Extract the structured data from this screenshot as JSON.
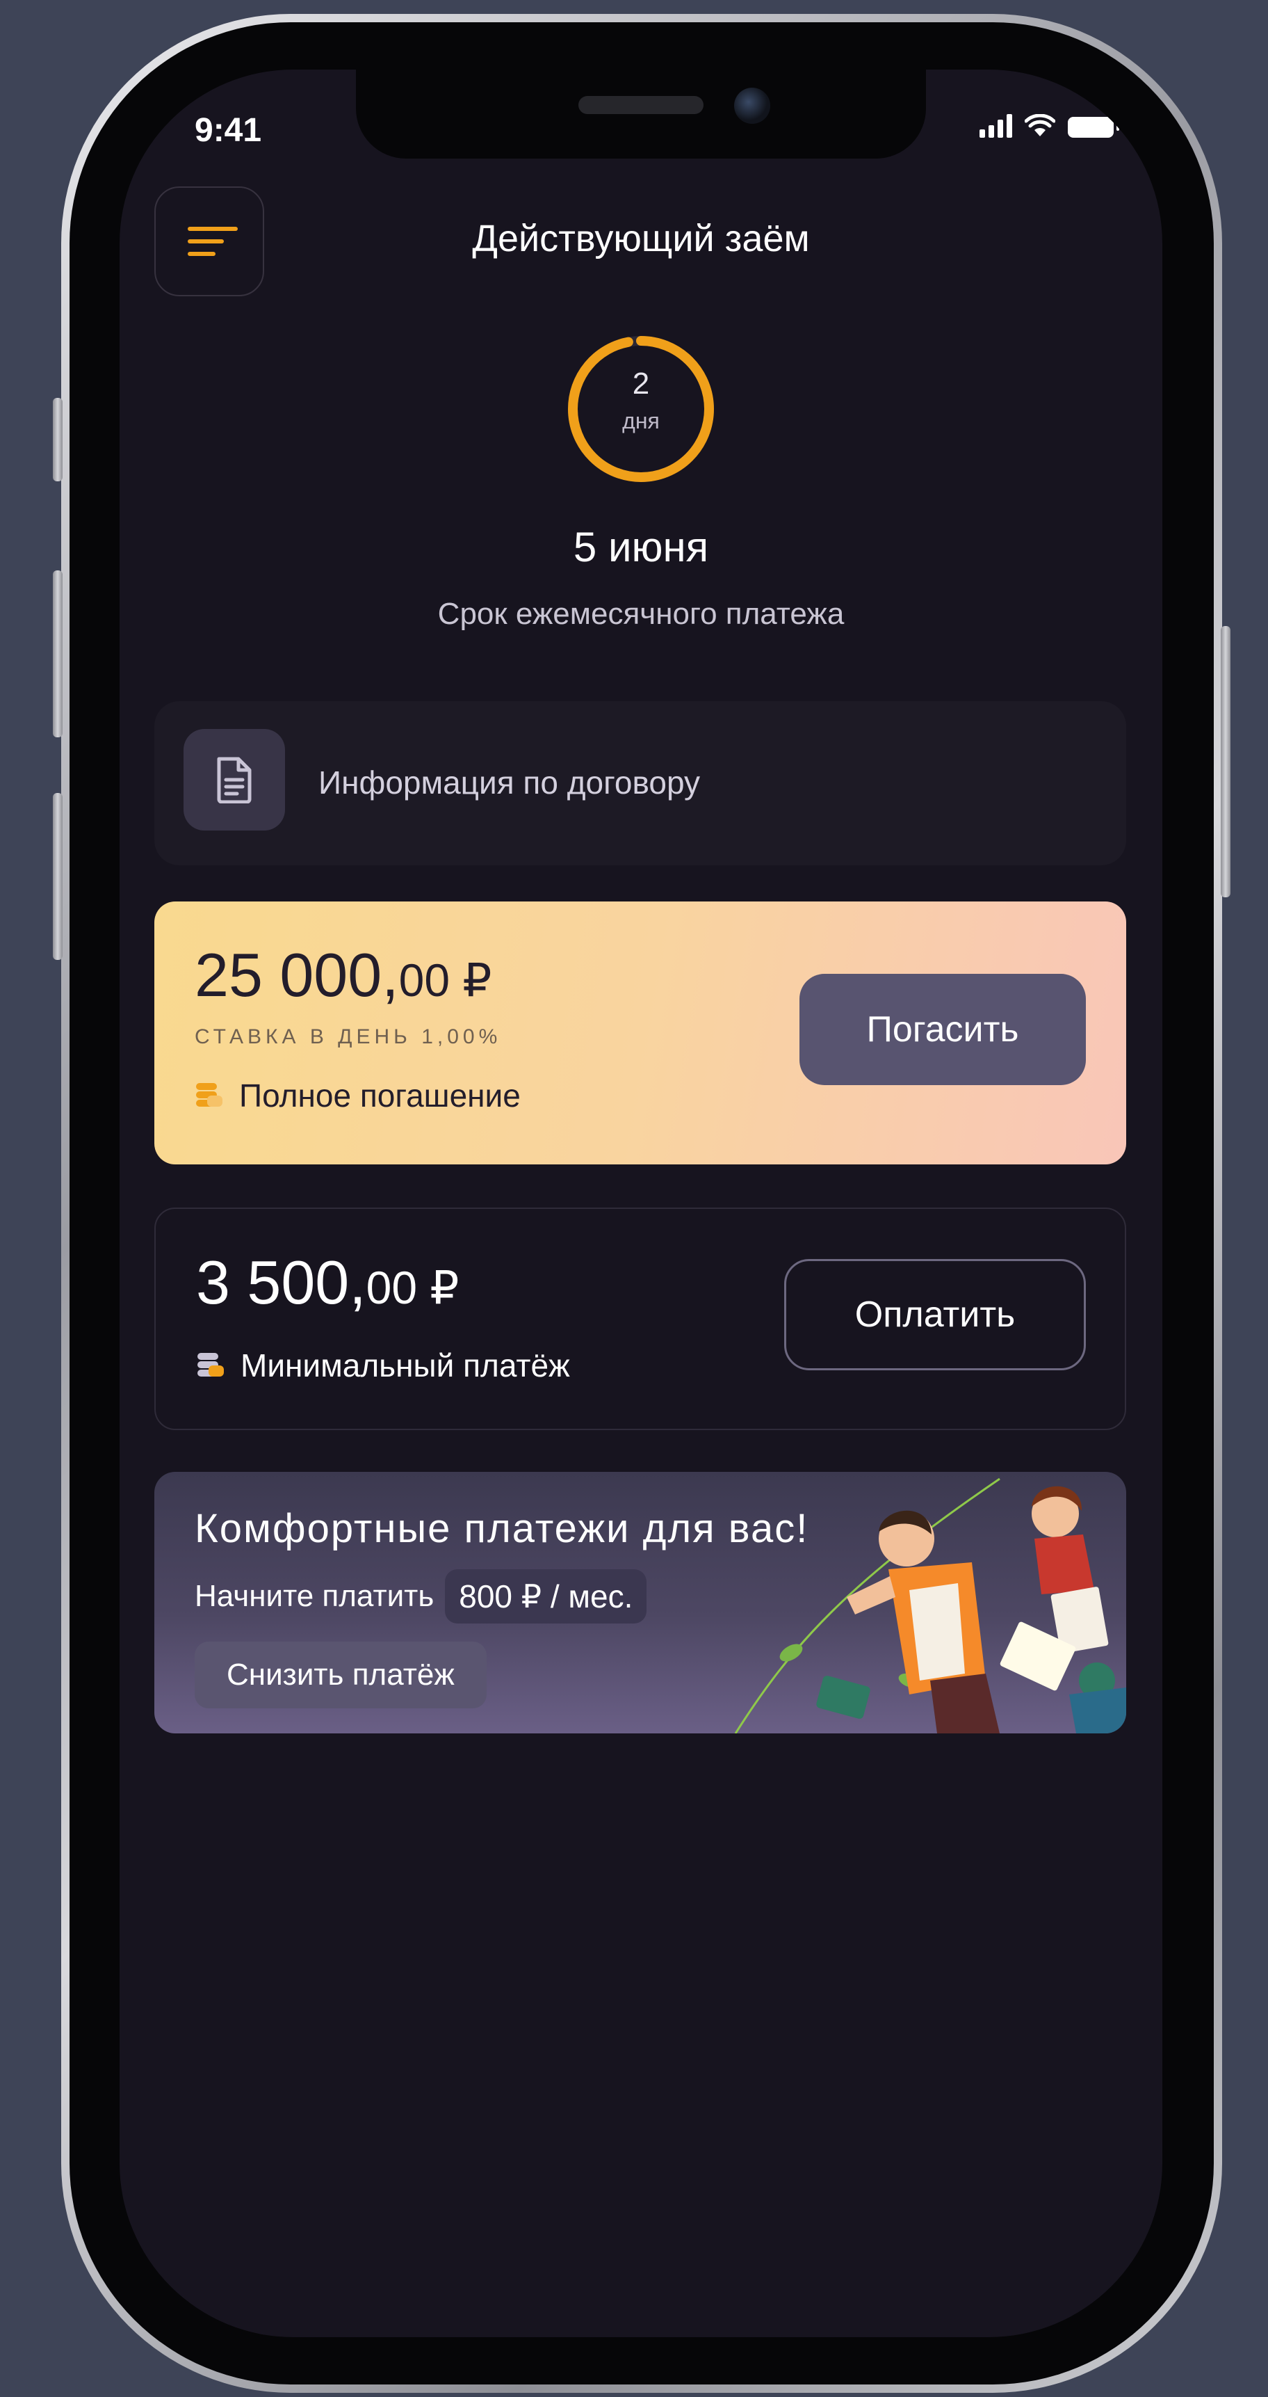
{
  "status_bar": {
    "time": "9:41"
  },
  "header": {
    "title": "Действующий заём"
  },
  "countdown": {
    "number": "2",
    "unit": "дня",
    "progress": 0.97
  },
  "due": {
    "date": "5 июня",
    "caption": "Срок ежемесячного платежа"
  },
  "contract": {
    "label": "Информация по договору"
  },
  "full_repayment": {
    "amount_main": "25 000,",
    "amount_cents": "00 ₽",
    "rate": "СТАВКА В ДЕНЬ 1,00%",
    "label": "Полное погашение",
    "button_label": "Погасить"
  },
  "minimum_payment": {
    "amount_main": "3 500,",
    "amount_cents": "00 ₽",
    "label": "Минимальный платёж",
    "button_label": "Оплатить"
  },
  "promo": {
    "title": "Комфортные платежи для вас!",
    "subtitle": "Начните платить",
    "chip": "800 ₽ / мес.",
    "button_label": "Снизить платёж"
  },
  "colors": {
    "accent": "#f0a01a",
    "background": "#17141f",
    "card_gold": "#f9d98f",
    "button_dark": "#585470"
  }
}
